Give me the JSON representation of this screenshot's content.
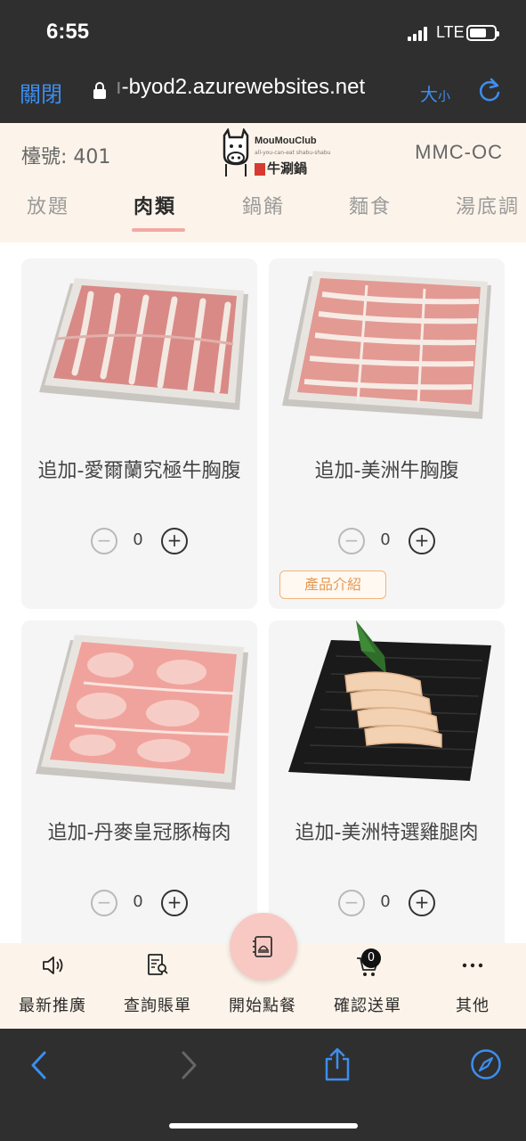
{
  "status_bar": {
    "time": "6:55",
    "network": "LTE"
  },
  "browser": {
    "close_label": "關閉",
    "url": "-byod2.azurewebsites.net",
    "font_size_label_big": "大",
    "font_size_label_small": "小"
  },
  "header": {
    "table_label": "檯號: 401",
    "logo_brand": "MouMouClub",
    "logo_tagline": "all-you-can-eat shabu-shabu",
    "logo_name": "牛涮鍋",
    "store_code": "MMC-OC"
  },
  "tabs": [
    {
      "label": "放題",
      "active": false
    },
    {
      "label": "肉類",
      "active": true
    },
    {
      "label": "鍋餚",
      "active": false
    },
    {
      "label": "麵食",
      "active": false
    },
    {
      "label": "湯底調",
      "active": false
    }
  ],
  "products": [
    {
      "name": "追加-愛爾蘭究極牛胸腹",
      "quantity": "0",
      "intro_label": ""
    },
    {
      "name": "追加-美洲牛胸腹",
      "quantity": "0",
      "intro_label": "產品介紹"
    },
    {
      "name": "追加-丹麥皇冠豚梅肉",
      "quantity": "0",
      "intro_label": ""
    },
    {
      "name": "追加-美洲特選雞腿肉",
      "quantity": "0",
      "intro_label": ""
    }
  ],
  "stepper": {
    "minus": "−",
    "plus": "+"
  },
  "bottom_nav": [
    {
      "label": "最新推廣",
      "icon": "speaker-icon"
    },
    {
      "label": "查詢賬單",
      "icon": "receipt-search-icon"
    },
    {
      "label": "開始點餐",
      "icon": "menu-book-icon"
    },
    {
      "label": "確認送單",
      "icon": "cart-icon"
    },
    {
      "label": "其他",
      "icon": "more-icon"
    }
  ],
  "cart_count": "0",
  "colors": {
    "header_bg": "#fcf4ea",
    "accent_pink": "#f4a9a4",
    "intro_orange": "#e69a52",
    "ios_blue": "#3c8ef0"
  }
}
